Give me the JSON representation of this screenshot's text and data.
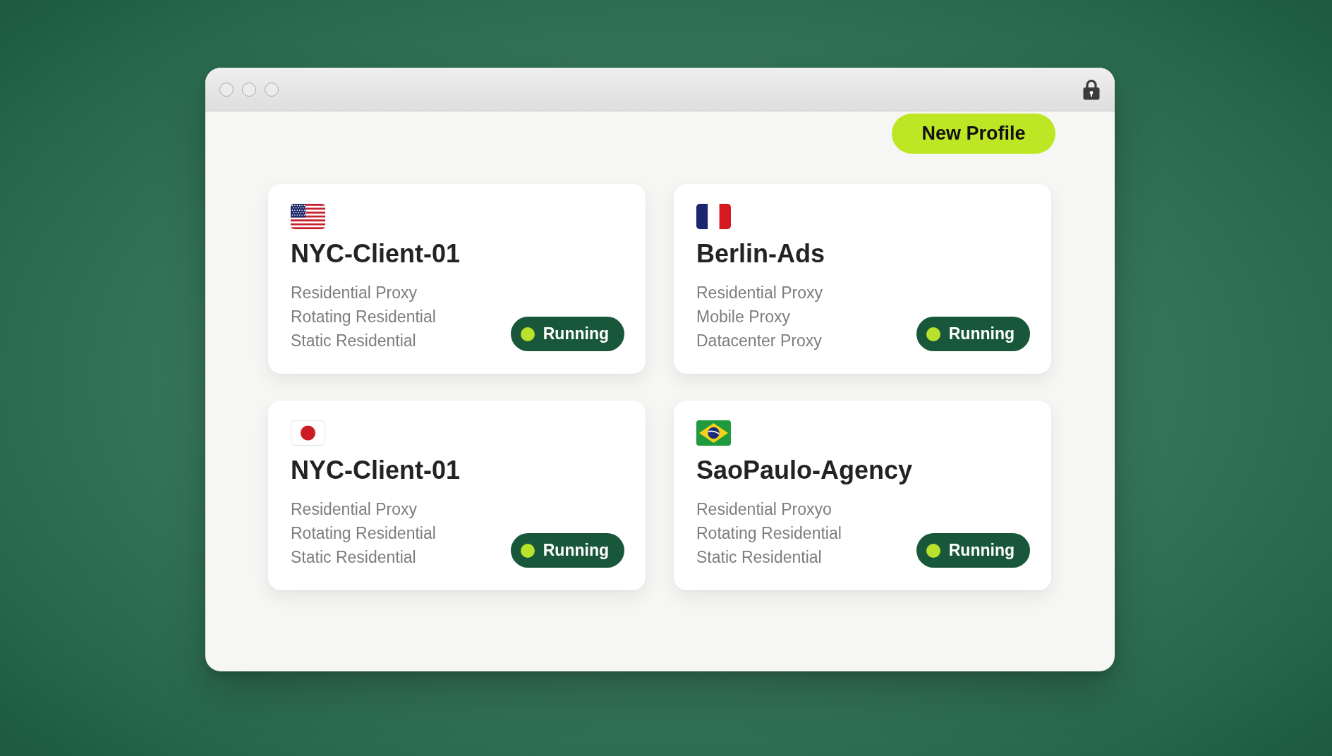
{
  "window": {
    "locked": true
  },
  "new_profile_button": {
    "label": "New Profile"
  },
  "profiles": [
    {
      "flag": {
        "kind": "us"
      },
      "name": "NYC-Client-01",
      "proxy_types": [
        "Residential Proxy",
        "Rotating Residential",
        "Static Residential"
      ],
      "status": {
        "kind": "running",
        "label": "Running"
      }
    },
    {
      "flag": {
        "kind": "fr"
      },
      "name": "Berlin-Ads",
      "proxy_types": [
        "Residential Proxy",
        "Mobile Proxy",
        "Datacenter Proxy"
      ],
      "status": {
        "kind": "running",
        "label": "Running"
      }
    },
    {
      "flag": {
        "kind": "jp"
      },
      "name": "NYC-Client-01",
      "proxy_types": [
        "Residential Proxy",
        "Rotating Residential",
        "Static Residential"
      ],
      "status": {
        "kind": "running",
        "label": "Running"
      }
    },
    {
      "flag": {
        "kind": "br"
      },
      "name": "SaoPaulo-Agency",
      "proxy_types": [
        "Residential Proxyo",
        "Rotating Residential",
        "Static Residential"
      ],
      "status": {
        "kind": "running",
        "label": "Running"
      }
    }
  ]
}
